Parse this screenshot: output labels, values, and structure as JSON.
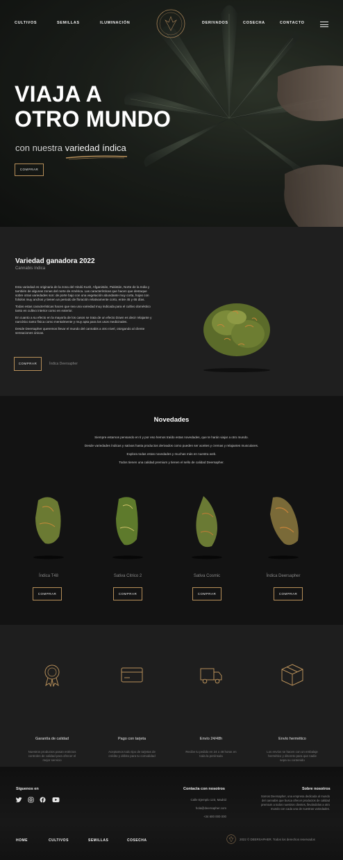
{
  "nav": {
    "items": [
      "CULTIVOS",
      "SEMILLAS",
      "ILUMINACIÓN",
      "DERIVADOS",
      "COSECHA",
      "CONTACTO"
    ]
  },
  "hero": {
    "title_line1": "VIAJA A",
    "title_line2": "OTRO MUNDO",
    "subtitle_prefix": "con nuestra",
    "subtitle_highlight": "variedad índica",
    "button": "COMPRAR"
  },
  "featured": {
    "title": "Variedad ganadora 2022",
    "subtitle": "Cannabis índica",
    "paragraphs": [
      "Esta variedad es originaria de la zona del Hindú Kush, Afganistán, Pakistán, Norte de la India y también de algunas zonas del norte de América. Las características que hacen que destaque sobre otras variedades son: de porte bajo con una vegetación abundante muy corta, hojas con foliolos muy anchos y tienen un periodo de floración relativamente corto, entre 45 y 65 días.",
      "Todas estas características hacen que sea una variedad muy indicada para el cultivo doméstico tanto en cultivo interior como en exterior.",
      "En cuanto a su efecto en la mayoría de los casos se trata de un efecto Down es decir relajante y narcótico tanto física como mentalmente y muy apta para los usos medicinales.",
      "Desde Deersapher queremos llevar el mundo del cannabis a otro nivel, otorgando al cliente sensaciones únicas."
    ],
    "button": "COMPRAR",
    "link": "Índica Deersapher"
  },
  "news": {
    "title": "Novedades",
    "lines": [
      "Siempre estamos pensando en ti y por eso hemos traído estas novedades, que te harán viajar a otro mundo.",
      "Desde variedades índicas y sativas hasta productos derivados como pueden ser aceites y cremas y relajantes musculares.",
      "Explora todas estas novedades y muchas más en nuestra web.",
      "Todos tienen una calidad premium y tienen el sello de calidad Deersapher."
    ],
    "products": [
      {
        "name": "Índica T48",
        "button": "COMPRAR"
      },
      {
        "name": "Sativa Citrico 2",
        "button": "COMPRAR"
      },
      {
        "name": "Sativa Cosmic",
        "button": "COMPRAR"
      },
      {
        "name": "Índica Deersapher",
        "button": "COMPRAR"
      }
    ]
  },
  "features": [
    {
      "title": "Garantía de calidad",
      "text": "Nuestros productos pasan estrictos controles de calidad para ofrecer el mejor servicio",
      "icon": "ribbon-badge-icon"
    },
    {
      "title": "Pago con tarjeta",
      "text": "Aceptamos todo tipo de tarjetas de crédito y débito para tu comodidad",
      "icon": "credit-card-icon"
    },
    {
      "title": "Envío 24/48h",
      "text": "Recibe tu pedido en 24 o 48 horas en toda la península",
      "icon": "delivery-truck-icon"
    },
    {
      "title": "Envío hermético",
      "text": "Los envíos se hacen con un embalaje hermético y discreto para que nadie sepa su contenido",
      "icon": "package-box-icon"
    }
  ],
  "footer": {
    "follow_title": "Síguenos en",
    "contact_title": "Contacta con nosotros",
    "contact_lines": [
      "Calle Ejemplo 123, Madrid",
      "hola@deersapher.com",
      "+34 600 000 000"
    ],
    "about_title": "Sobre nosotros",
    "about_text": "Somos Deersapher, una empresa dedicada al mundo del cannabis que busca ofrecer productos de calidad premium a todos nuestros clientes, llevándolos a otro mundo con cada una de nuestras variedades.",
    "nav": [
      "HOME",
      "CULTIVOS",
      "SEMILLAS",
      "COSECHA"
    ],
    "copyright": "2022 © DEERSAPHER. Todos los derechos reservados"
  },
  "colors": {
    "accent": "#b8905a",
    "background": "#1c1c1c"
  }
}
